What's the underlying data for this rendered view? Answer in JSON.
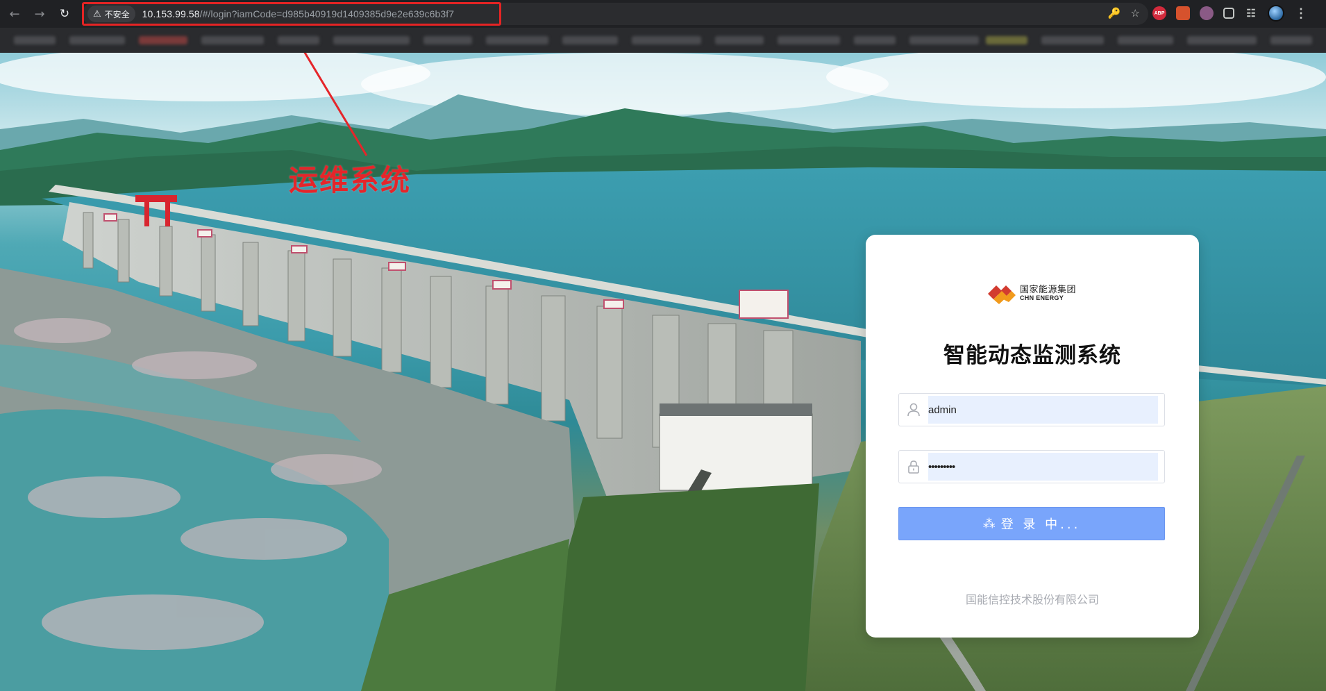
{
  "browser": {
    "security_chip": "不安全",
    "url_host": "10.153.99.58",
    "url_path": "/#/login?iamCode=d985b40919d1409385d9e2e639c6b3f7",
    "extensions": [
      "ABP",
      "shield-extension",
      "pink-extension",
      "box-extension",
      "puzzle-extension"
    ]
  },
  "annotation": {
    "label": "运维系统",
    "color": "#e5252a"
  },
  "login": {
    "logo_cn": "国家能源集团",
    "logo_en": "CHN ENERGY",
    "title": "智能动态监测系统",
    "username_value": "admin",
    "password_value": "•••••••••",
    "button_label": "登 录 中...",
    "footer": "国能信控技术股份有限公司",
    "accent_color": "#79a5fb"
  }
}
